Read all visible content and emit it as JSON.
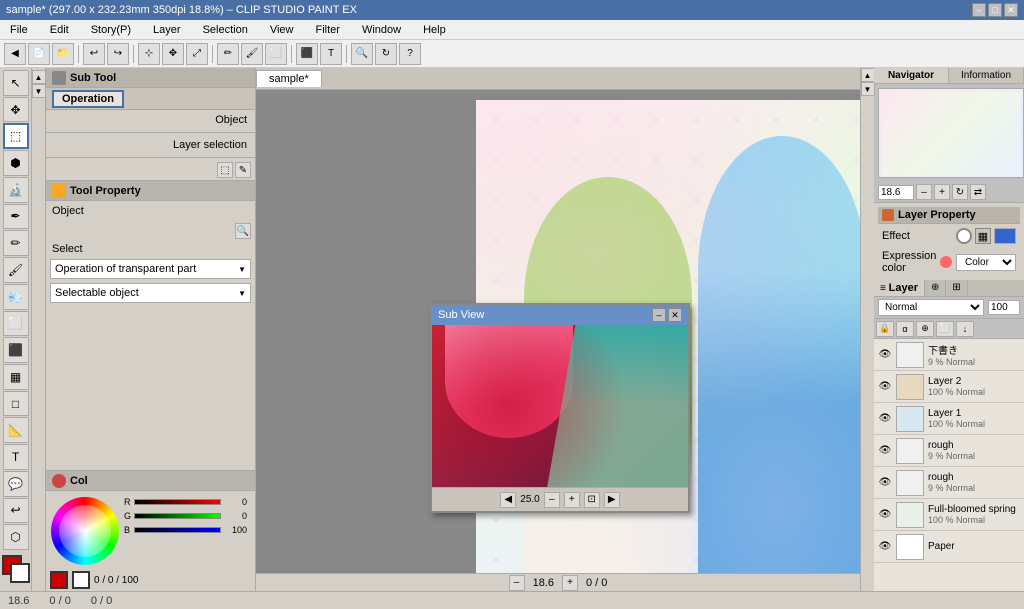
{
  "titleBar": {
    "title": "sample* (297.00 x 232.23mm 350dpi 18.8%) – CLIP STUDIO PAINT EX",
    "buttons": [
      "–",
      "□",
      "✕"
    ]
  },
  "menuBar": {
    "items": [
      "File",
      "Edit",
      "Story(P)",
      "Layer",
      "Selection",
      "View",
      "Filter",
      "Window",
      "Help"
    ]
  },
  "subToolPanel": {
    "header": "Sub Tool",
    "tab": "Operation",
    "objectLabel": "Object",
    "layerSelectionLabel": "Layer selection"
  },
  "toolProperty": {
    "header": "Tool Property",
    "objectLabel": "Object",
    "selectLabel": "Select",
    "dropdown1": "Operation of transparent part",
    "dropdown2": "Selectable object"
  },
  "canvasTab": {
    "name": "sample*"
  },
  "subView": {
    "header": "Sub View",
    "zoom": "25.0"
  },
  "navigator": {
    "tabActive": "Navigator",
    "tabInactive": "Information",
    "zoom": "18.6"
  },
  "layerProperty": {
    "header": "Layer Property",
    "effectLabel": "Effect",
    "expressionColorLabel": "Expression color",
    "colorLabel": "Color"
  },
  "layerPanel": {
    "header": "Layer",
    "mode": "Normal",
    "opacity": "100",
    "layers": [
      {
        "name": "下書き",
        "meta": "9 % Normal",
        "visible": true,
        "thumb_color": "#f0f0f0"
      },
      {
        "name": "Layer 2",
        "meta": "100 % Normal",
        "visible": true,
        "thumb_color": "#e8d8c0"
      },
      {
        "name": "Layer 1",
        "meta": "100 % Normal",
        "visible": true,
        "thumb_color": "#d8e8f0"
      },
      {
        "name": "rough",
        "meta": "9 % Normal",
        "visible": true,
        "thumb_color": "#f0f0f0"
      },
      {
        "name": "rough",
        "meta": "9 % Normal",
        "visible": true,
        "thumb_color": "#f0f0f0"
      },
      {
        "name": "Full-bloomed spring",
        "meta": "100 % Normal",
        "visible": true,
        "thumb_color": "#e8f0e8"
      },
      {
        "name": "Paper",
        "meta": "",
        "visible": true,
        "thumb_color": "#ffffff"
      }
    ]
  },
  "statusBar": {
    "zoom": "18.6",
    "coords": "0 / 0",
    "size": "0 / 0"
  },
  "colorPanel": {
    "header": "Col",
    "r": 0,
    "g": 0,
    "b": 100
  }
}
